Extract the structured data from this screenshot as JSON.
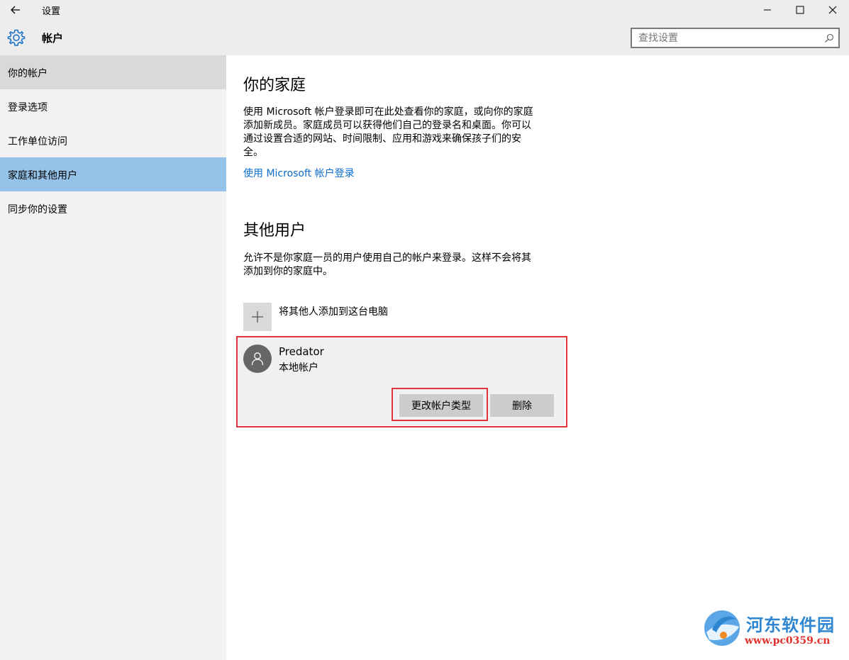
{
  "window": {
    "title": "设置"
  },
  "header": {
    "section": "帐户",
    "search_placeholder": "查找设置"
  },
  "sidebar": {
    "items": [
      {
        "label": "你的帐户",
        "state": "hover"
      },
      {
        "label": "登录选项",
        "state": "normal"
      },
      {
        "label": "工作单位访问",
        "state": "normal"
      },
      {
        "label": "家庭和其他用户",
        "state": "selected"
      },
      {
        "label": "同步你的设置",
        "state": "normal"
      }
    ]
  },
  "family": {
    "heading": "你的家庭",
    "description_lines": [
      "使用 Microsoft 帐户登录即可在此处查看你的家庭，或向你的家庭",
      "添加新成员。家庭成员可以获得他们自己的登录名和桌面。你可以",
      "通过设置合适的网站、时间限制、应用和游戏来确保孩子们的安",
      "全。"
    ],
    "signin_link": "使用 Microsoft 帐户登录"
  },
  "others": {
    "heading": "其他用户",
    "description_lines": [
      "允许不是你家庭一员的用户使用自己的帐户来登录。这样不会将其",
      "添加到你的家庭中。"
    ],
    "add_label": "将其他人添加到这台电脑",
    "user": {
      "name": "Predator",
      "type": "本地帐户",
      "change_type_button": "更改帐户类型",
      "delete_button": "删除"
    }
  },
  "watermark": {
    "name": "河东软件园",
    "url": "www.pc0359.cn"
  },
  "colors": {
    "accent": "#0a6ccb",
    "selected_nav": "#94c2e8",
    "highlight_outline": "#e3353b"
  }
}
